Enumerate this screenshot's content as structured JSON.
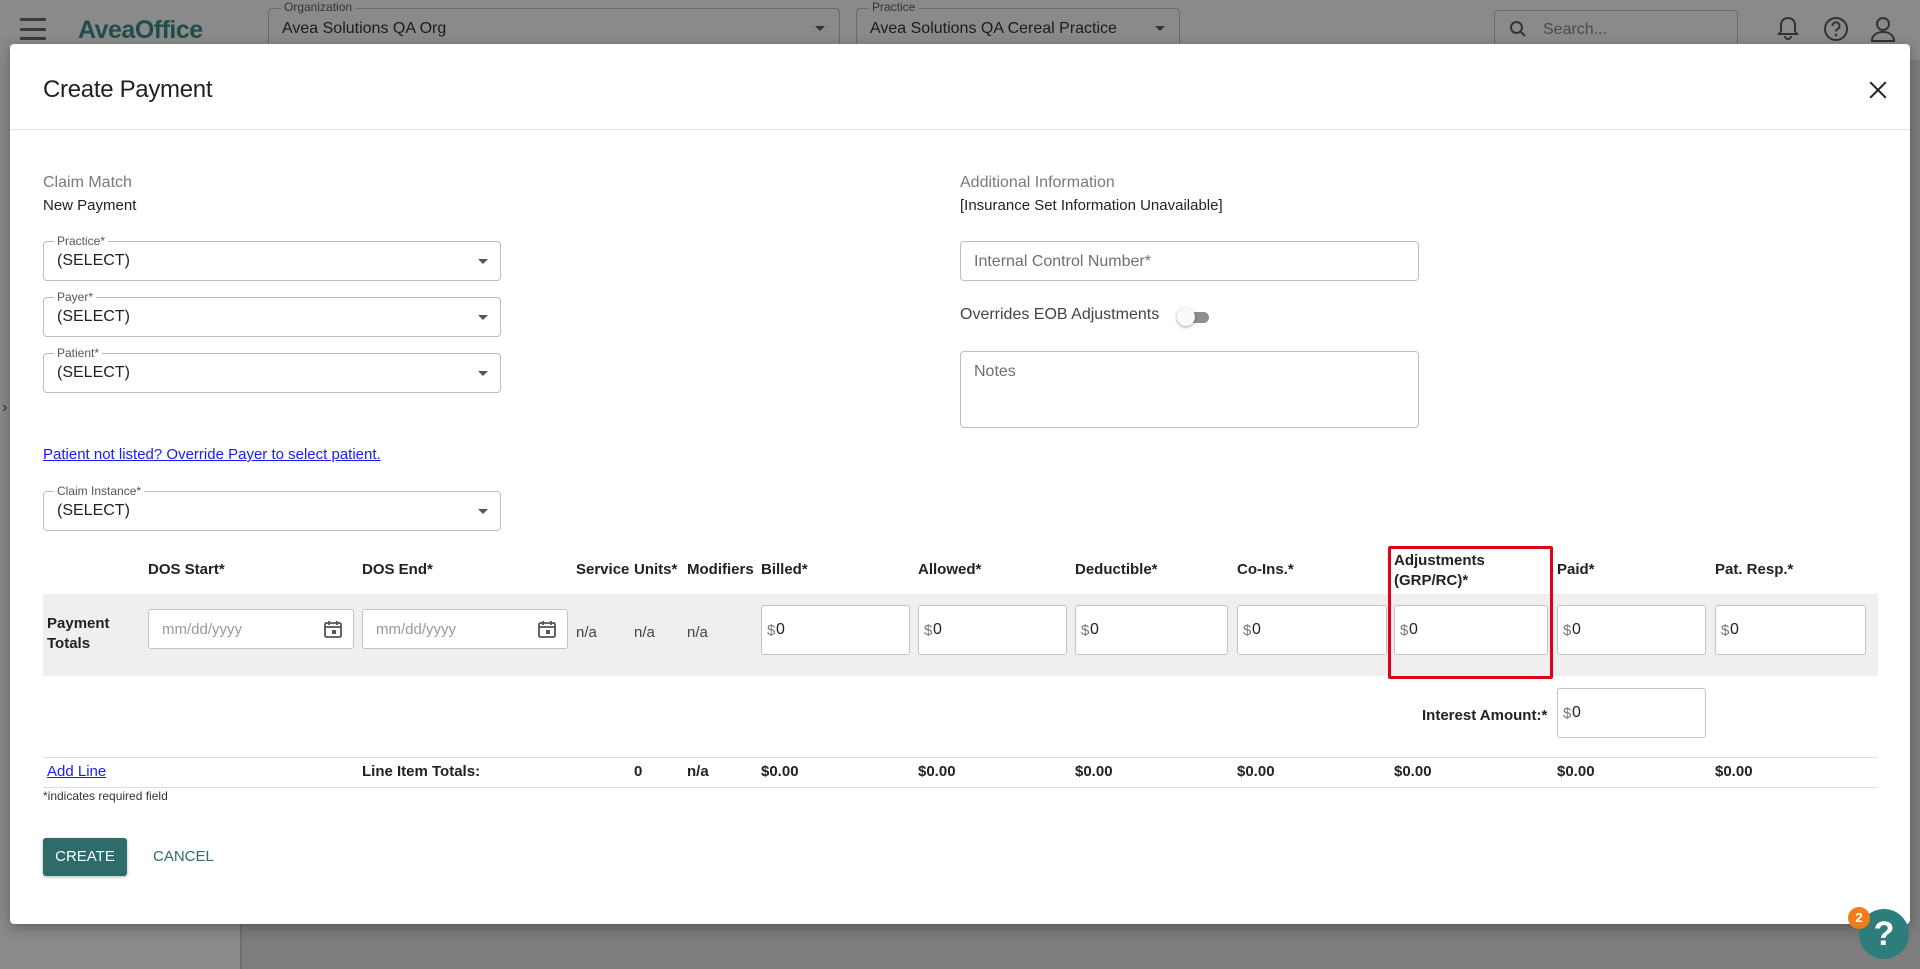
{
  "app": {
    "brand": "AveaOffice",
    "organization": {
      "label": "Organization",
      "value": "Avea Solutions QA Org"
    },
    "practice": {
      "label": "Practice",
      "value": "Avea Solutions QA Cereal Practice"
    },
    "search_placeholder": "Search...",
    "icons": [
      "menu-icon",
      "bell-icon",
      "help-icon",
      "account-icon"
    ]
  },
  "modal": {
    "title": "Create Payment",
    "claim_match": {
      "title": "Claim Match",
      "subtitle": "New Payment",
      "practice": {
        "label": "Practice*",
        "value": "(SELECT)"
      },
      "payer": {
        "label": "Payer*",
        "value": "(SELECT)"
      },
      "patient": {
        "label": "Patient*",
        "value": "(SELECT)"
      },
      "override_link": "Patient not listed? Override Payer to select patient.",
      "claim_instance": {
        "label": "Claim Instance*",
        "value": "(SELECT)"
      }
    },
    "additional_info": {
      "title": "Additional Information",
      "subtitle": "[Insurance Set Information Unavailable]",
      "icn_placeholder": "Internal Control Number*",
      "overrides_label": "Overrides EOB Adjustments",
      "overrides_on": false,
      "notes_placeholder": "Notes"
    },
    "table": {
      "headers": {
        "dos_start": "DOS Start*",
        "dos_end": "DOS End*",
        "service": "Service",
        "units": "Units*",
        "modifiers": "Modifiers",
        "billed": "Billed*",
        "allowed": "Allowed*",
        "deductible": "Deductible*",
        "coins": "Co-Ins.*",
        "adjustments_1": "Adjustments",
        "adjustments_2": "(GRP/RC)*",
        "paid": "Paid*",
        "pat_resp": "Pat. Resp.*"
      },
      "payment_totals": {
        "label_1": "Payment",
        "label_2": "Totals",
        "date_placeholder": "mm/dd/yyyy",
        "service": "n/a",
        "units": "n/a",
        "modifiers": "n/a",
        "currency": "$",
        "billed": "0",
        "allowed": "0",
        "deductible": "0",
        "coins": "0",
        "adjustments": "0",
        "paid": "0",
        "pat_resp": "0"
      },
      "interest": {
        "label": "Interest Amount:*",
        "value": "0"
      },
      "add_line": "Add Line",
      "line_item_totals": {
        "label": "Line Item Totals:",
        "units": "0",
        "modifiers": "n/a",
        "billed": "$0.00",
        "allowed": "$0.00",
        "deductible": "$0.00",
        "coins": "$0.00",
        "adjustments": "$0.00",
        "paid": "$0.00",
        "pat_resp": "$0.00"
      },
      "required_note": "*indicates required field"
    },
    "buttons": {
      "create": "CREATE",
      "cancel": "CANCEL"
    }
  },
  "help": {
    "badge_count": "2",
    "glyph": "?"
  },
  "colors": {
    "primary": "#2e6b6b",
    "highlight": "#e0001a",
    "link": "#1a1aff",
    "badge": "#f07c1a"
  }
}
